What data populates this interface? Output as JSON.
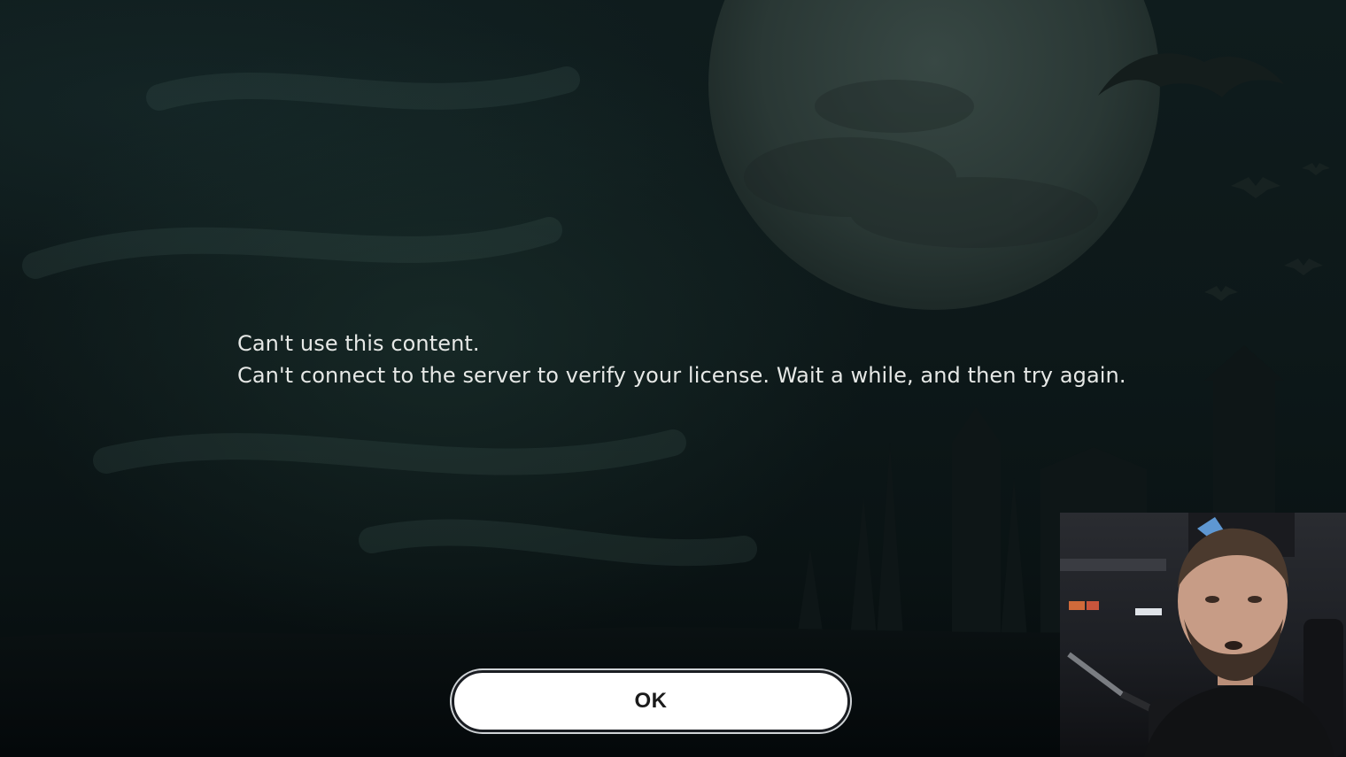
{
  "dialog": {
    "title": "Can't use this content.",
    "message": "Can't connect to the server to verify your license. Wait a while, and then try again.",
    "ok_label": "OK"
  },
  "colors": {
    "background": "#0b1415",
    "text": "#e6e8e6",
    "button_bg": "#ffffff",
    "button_text": "#1b1b1b"
  }
}
